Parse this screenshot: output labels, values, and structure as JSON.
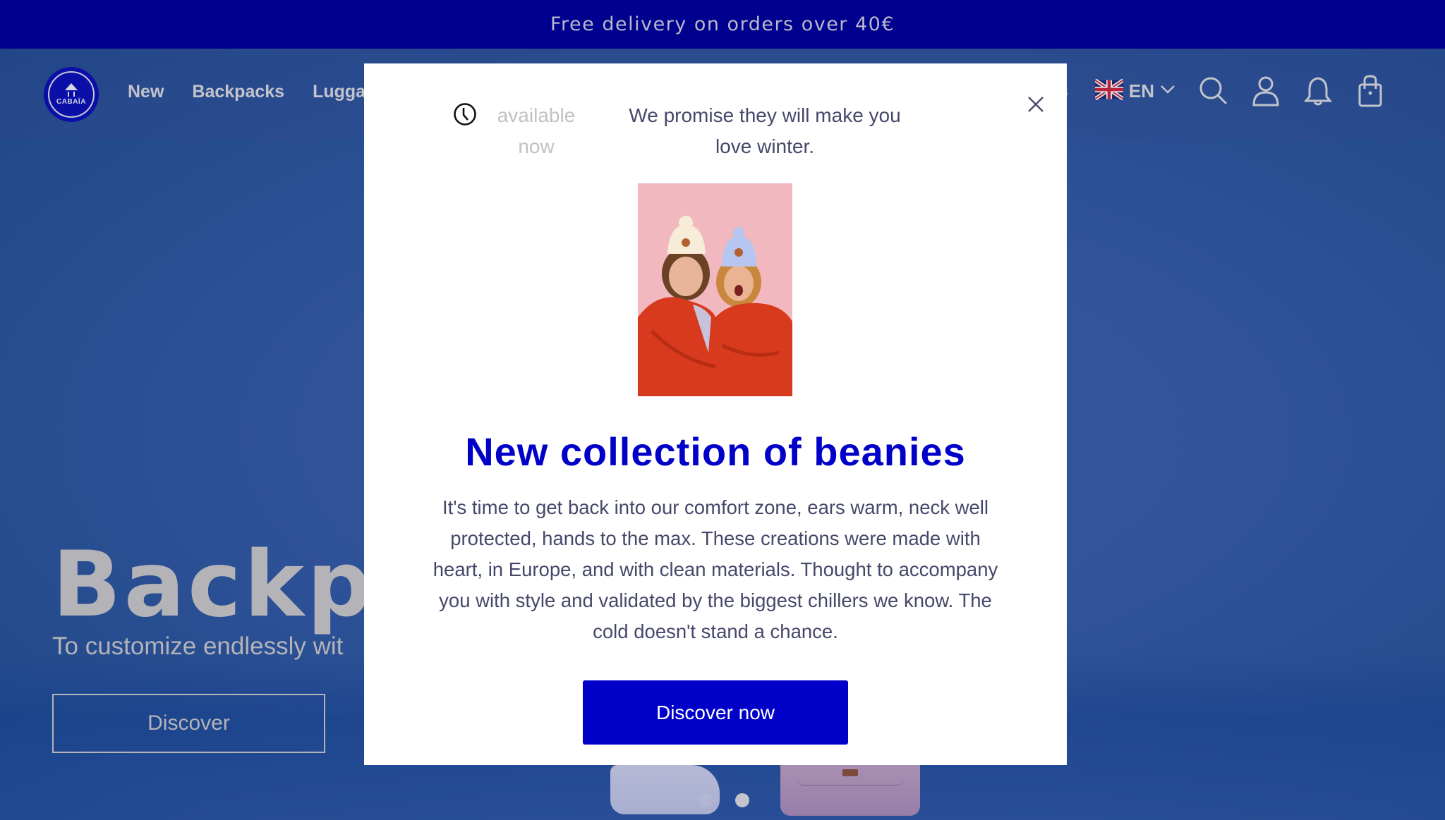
{
  "promo_bar": {
    "text": "Free delivery on orders over 40€"
  },
  "header": {
    "logo_text": "CABAÏA",
    "nav_items": [
      "New",
      "Backpacks",
      "Lugga"
    ],
    "nav_partial_right": "s",
    "language": {
      "code": "EN",
      "flag": "uk-flag-icon"
    },
    "icons": [
      "search-icon",
      "account-icon",
      "notification-bell-icon",
      "shopping-bag-icon"
    ]
  },
  "hero": {
    "title": "Backpa",
    "subtitle": "To customize endlessly wit",
    "button_label": "Discover",
    "carousel": {
      "total_dots": 2,
      "active_index": 1
    }
  },
  "modal": {
    "availability": {
      "icon": "clock-icon",
      "text": "available now"
    },
    "tagline": "We promise they will make you love winter.",
    "image_alt": "Two people wearing beanies wrapped in a red blanket",
    "title": "New collection of beanies",
    "body": "It's time to get back into our comfort zone, ears warm, neck well protected, hands to the max. These creations were made with heart, in Europe, and with clean materials. Thought to accompany you with style and validated by the biggest chillers we know. The cold doesn't stand a chance.",
    "cta_label": "Discover now",
    "close_icon": "close-icon"
  },
  "colors": {
    "promo_bg": "#00008f",
    "brand_blue": "#0000c8",
    "hero_bg": "#30539a",
    "body_text": "#46486a",
    "muted_text": "#c1c1c6"
  }
}
